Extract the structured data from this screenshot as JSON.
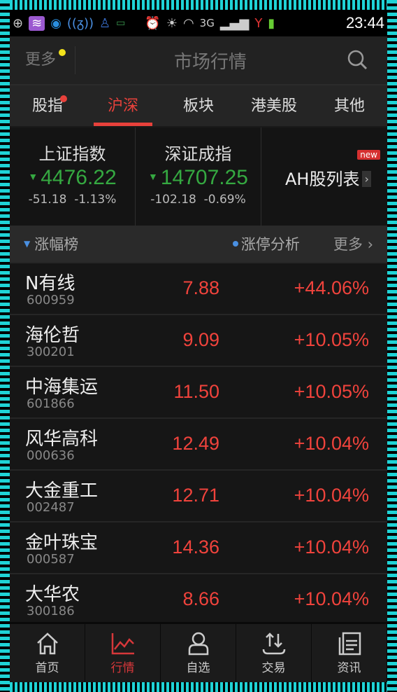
{
  "status": {
    "time": "23:44",
    "network": "3G"
  },
  "header": {
    "more_label": "更多",
    "title": "市场行情"
  },
  "tabs": [
    {
      "label": "股指"
    },
    {
      "label": "沪深"
    },
    {
      "label": "板块"
    },
    {
      "label": "港美股"
    },
    {
      "label": "其他"
    }
  ],
  "active_tab": "沪深",
  "indices": [
    {
      "name": "上证指数",
      "value": "4476.22",
      "change": "-51.18",
      "percent": "-1.13%"
    },
    {
      "name": "深证成指",
      "value": "14707.25",
      "change": "-102.18",
      "percent": "-0.69%"
    }
  ],
  "ah": {
    "label": "AH股列表",
    "badge": "new"
  },
  "list_header": {
    "title": "涨幅榜",
    "analysis": "涨停分析",
    "more": "更多 ›"
  },
  "stocks": [
    {
      "name": "N有线",
      "code": "600959",
      "price": "7.88",
      "change": "+44.06%"
    },
    {
      "name": "海伦哲",
      "code": "300201",
      "price": "9.09",
      "change": "+10.05%"
    },
    {
      "name": "中海集运",
      "code": "601866",
      "price": "11.50",
      "change": "+10.05%"
    },
    {
      "name": "风华高科",
      "code": "000636",
      "price": "12.49",
      "change": "+10.04%"
    },
    {
      "name": "大金重工",
      "code": "002487",
      "price": "12.71",
      "change": "+10.04%"
    },
    {
      "name": "金叶珠宝",
      "code": "000587",
      "price": "14.36",
      "change": "+10.04%"
    },
    {
      "name": "大华农",
      "code": "300186",
      "price": "8.66",
      "change": "+10.04%"
    }
  ],
  "nav": [
    {
      "label": "首页",
      "icon": "home-icon"
    },
    {
      "label": "行情",
      "icon": "chart-icon"
    },
    {
      "label": "自选",
      "icon": "person-icon"
    },
    {
      "label": "交易",
      "icon": "transfer-icon"
    },
    {
      "label": "资讯",
      "icon": "news-icon"
    }
  ],
  "colors": {
    "up": "#f0433c",
    "down": "#35a941",
    "accent": "#e8413b",
    "frame": "#1fd3d6"
  }
}
